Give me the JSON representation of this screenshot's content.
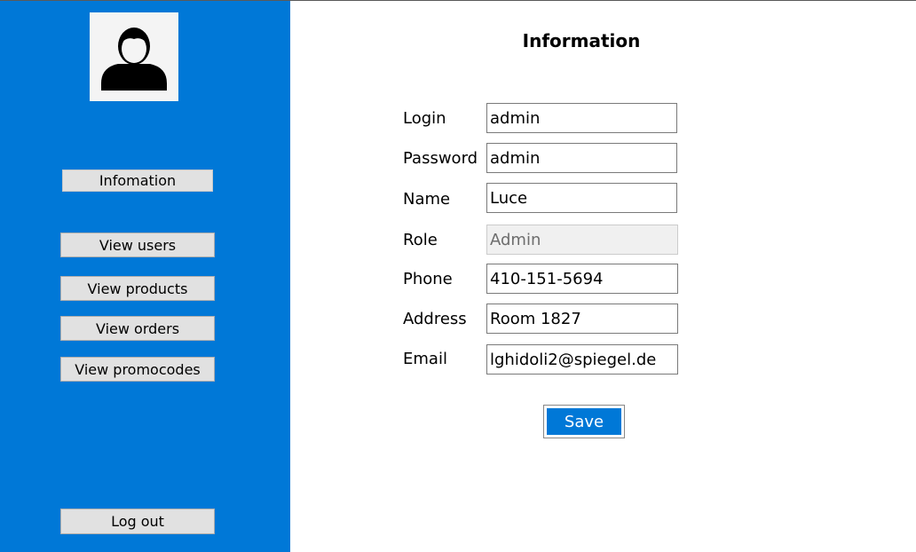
{
  "sidebar": {
    "avatar_icon": "user-silhouette-icon",
    "colors": {
      "background": "#0078d7"
    },
    "nav": {
      "information": "Infomation",
      "view_users": "View users",
      "view_products": "View products",
      "view_orders": "View orders",
      "view_promocodes": "View promocodes",
      "logout": "Log out"
    }
  },
  "main": {
    "title": "Information",
    "fields": {
      "login": {
        "label": "Login",
        "value": "admin"
      },
      "password": {
        "label": "Password",
        "value": "admin"
      },
      "name": {
        "label": "Name",
        "value": "Luce"
      },
      "role": {
        "label": "Role",
        "value": "Admin",
        "disabled": true
      },
      "phone": {
        "label": "Phone",
        "value": "410-151-5694"
      },
      "address": {
        "label": "Address",
        "value": "Room 1827"
      },
      "email": {
        "label": "Email",
        "value": "lghidoli2@spiegel.de"
      }
    },
    "save_label": "Save",
    "colors": {
      "accent": "#0078d7"
    }
  }
}
